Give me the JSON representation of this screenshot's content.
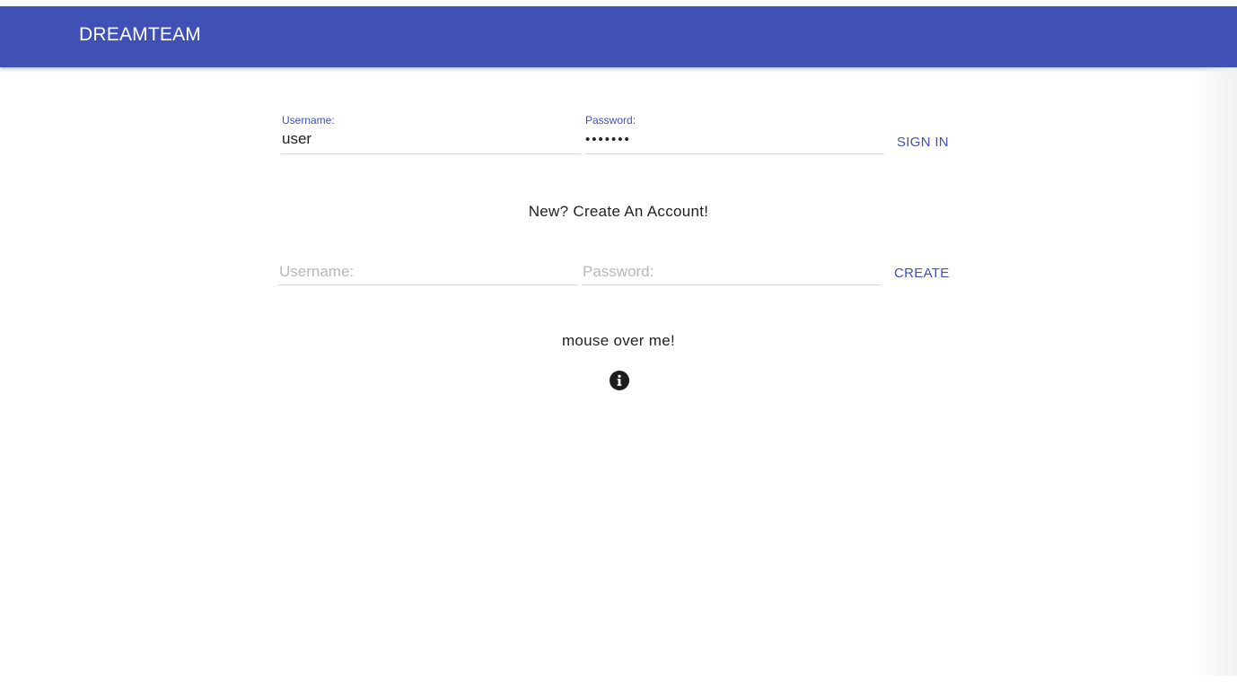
{
  "app": {
    "title": "DREAMTEAM"
  },
  "sign_in": {
    "username_label": "Username:",
    "username_value": "user",
    "password_label": "Password:",
    "password_value": "•••••••",
    "button_label": "SIGN IN"
  },
  "create": {
    "heading": "New? Create An Account!",
    "username_placeholder": "Username:",
    "password_placeholder": "Password:",
    "button_label": "CREATE"
  },
  "hover": {
    "text": "mouse over me!",
    "icon": "info-icon"
  },
  "colors": {
    "primary": "#3f51b5",
    "text": "#222222",
    "placeholder": "#b8b8b8"
  }
}
